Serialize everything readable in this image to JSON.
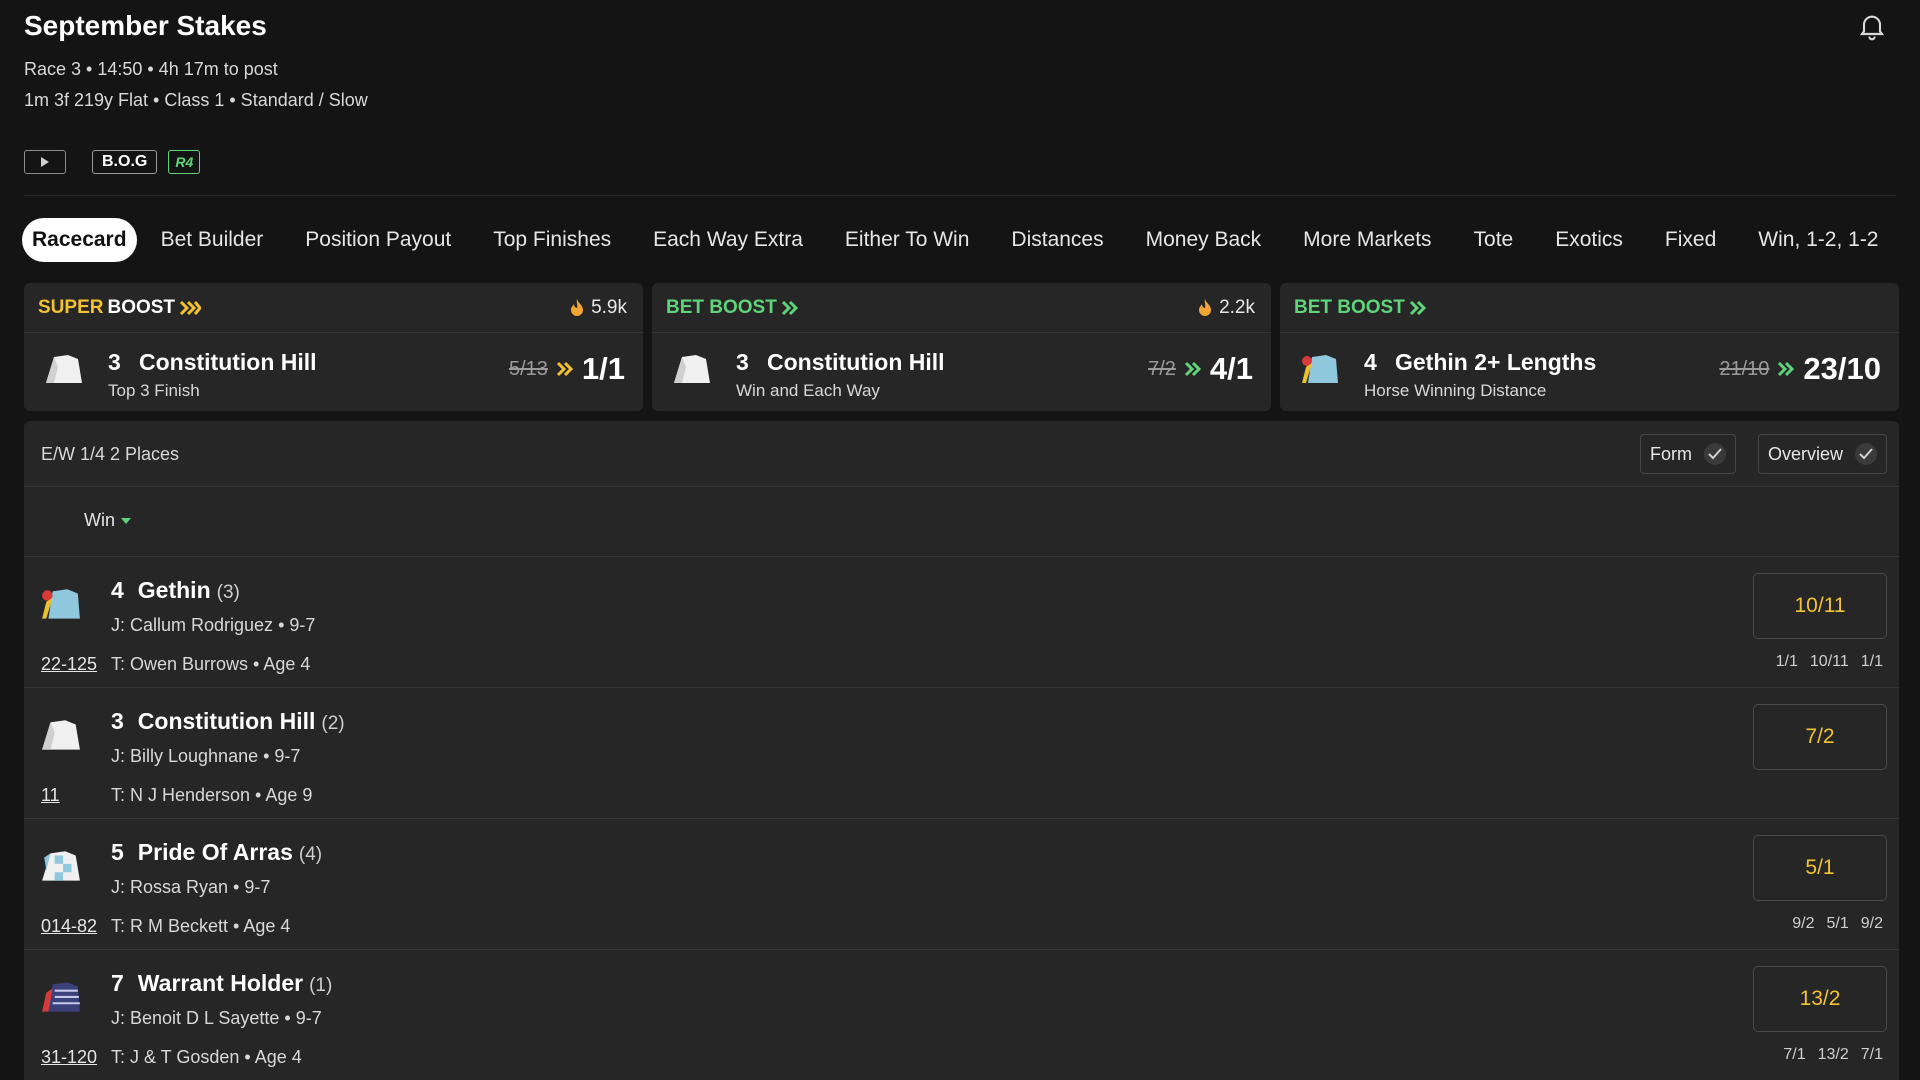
{
  "header": {
    "title": "September Stakes",
    "meta_line1": "Race 3 • 14:50 • 4h 17m to post",
    "meta_line2": "1m 3f 219y Flat  • Class 1  • Standard / Slow",
    "badge_bog": "B.O.G",
    "badge_r4": "R4"
  },
  "tabs": [
    "Racecard",
    "Bet Builder",
    "Position Payout",
    "Top Finishes",
    "Each Way Extra",
    "Either To Win",
    "Distances",
    "Money Back",
    "More Markets",
    "Tote",
    "Exotics",
    "Fixed",
    "Win, 1-2, 1-2"
  ],
  "boosts": [
    {
      "label_a": "SUPER",
      "label_b": "BOOST",
      "count": "5.9k",
      "num": "3",
      "runner": "Constitution Hill",
      "market": "Top 3 Finish",
      "old_odds": "5/13",
      "new_odds": "1/1",
      "chev_color": "#f2c230"
    },
    {
      "label_a": "",
      "label_b": "BET BOOST",
      "count": "2.2k",
      "num": "3",
      "runner": "Constitution Hill",
      "market": "Win and Each Way",
      "old_odds": "7/2",
      "new_odds": "4/1",
      "chev_color": "#5fd47a"
    },
    {
      "label_a": "",
      "label_b": "BET BOOST",
      "count": "",
      "num": "4",
      "runner": "Gethin 2+ Lengths",
      "market": "Horse Winning Distance",
      "old_odds": "21/10",
      "new_odds": "23/10",
      "chev_color": "#5fd47a"
    }
  ],
  "card": {
    "each_way": "E/W 1/4 2 Places",
    "toggle_form": "Form",
    "toggle_overview": "Overview",
    "sort_label": "Win"
  },
  "runners": [
    {
      "num": "4",
      "name": "Gethin",
      "draw": "(3)",
      "jockey": "J: Callum Rodriguez • 9-7",
      "form": "22-125",
      "trainer": "T: Owen Burrows • Age 4",
      "odds": "10/11",
      "history": [
        "1/1",
        "10/11",
        "1/1"
      ]
    },
    {
      "num": "3",
      "name": "Constitution Hill",
      "draw": "(2)",
      "jockey": "J: Billy Loughnane • 9-7",
      "form": "11",
      "trainer": "T: N J Henderson • Age 9",
      "odds": "7/2",
      "history": []
    },
    {
      "num": "5",
      "name": "Pride Of Arras",
      "draw": "(4)",
      "jockey": "J: Rossa Ryan • 9-7",
      "form": "014-82",
      "trainer": "T: R M Beckett • Age 4",
      "odds": "5/1",
      "history": [
        "9/2",
        "5/1",
        "9/2"
      ]
    },
    {
      "num": "7",
      "name": "Warrant Holder",
      "draw": "(1)",
      "jockey": "J: Benoit D L Sayette • 9-7",
      "form": "31-120",
      "trainer": "T: J & T Gosden • Age 4",
      "odds": "13/2",
      "history": [
        "7/1",
        "13/2",
        "7/1"
      ]
    }
  ],
  "colors": {
    "background": "#141414",
    "panel": "#262626",
    "accent_yellow": "#f2c230",
    "accent_green": "#5fd47a"
  },
  "icons": {
    "bell": "bell-icon",
    "play": "play-icon",
    "flame": "flame-icon",
    "check": "check-icon",
    "caret": "caret-down-icon",
    "chevron": "double-chevron-icon"
  }
}
